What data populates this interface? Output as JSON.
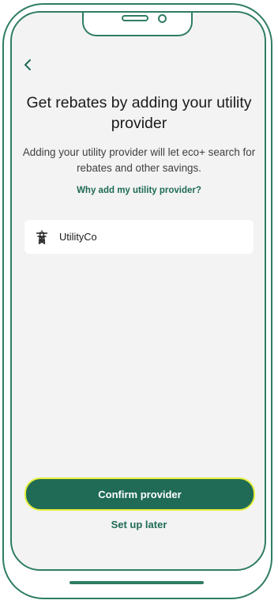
{
  "header": {
    "back_icon": "chevron-left-icon"
  },
  "main": {
    "title": "Get rebates by adding your utility provider",
    "subtitle": "Adding your utility provider will let eco+ search for rebates and other savings.",
    "why_link": "Why add my utility provider?",
    "provider": {
      "icon": "power-tower-icon",
      "name": "UtilityCo"
    }
  },
  "footer": {
    "confirm_label": "Confirm provider",
    "later_label": "Set up later"
  },
  "colors": {
    "brand_green": "#1f6b56",
    "frame_green": "#2f7d63",
    "focus_outline": "#e3ee3a",
    "screen_background": "#f3f3f3"
  }
}
